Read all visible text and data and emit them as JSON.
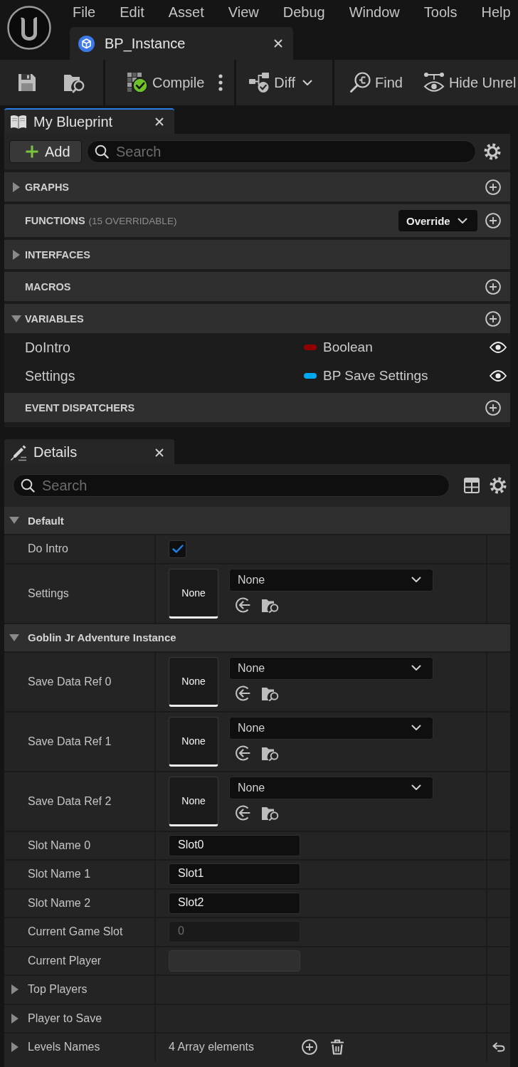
{
  "menu_bar": {
    "items": [
      "File",
      "Edit",
      "Asset",
      "View",
      "Debug",
      "Window",
      "Tools",
      "Help"
    ]
  },
  "document_tabs": [
    {
      "title": "BP_Instance",
      "selected": true
    }
  ],
  "toolbar": {
    "groups": [
      [
        {
          "kind": "save"
        },
        {
          "kind": "browse"
        }
      ],
      [
        {
          "kind": "compile",
          "label": "Compile"
        },
        {
          "kind": "more"
        }
      ],
      [
        {
          "kind": "diff",
          "label": "Diff"
        }
      ],
      [
        {
          "kind": "find",
          "label": "Find"
        },
        {
          "kind": "hide",
          "label": "Hide Unrel"
        }
      ]
    ]
  },
  "my_blueprint": {
    "tab": {
      "title": "My Blueprint",
      "active": true
    },
    "add_button": {
      "label": "Add"
    },
    "search": {
      "placeholder": "Search"
    },
    "sections": [
      {
        "title": "GRAPHS",
        "expanded": false,
        "add": true
      },
      {
        "title": "FUNCTIONS",
        "note": "(15 OVERRIDABLE)",
        "dropdown": "Override",
        "add": true
      },
      {
        "title": "INTERFACES",
        "expanded": false,
        "add": false
      },
      {
        "title": "MACROS",
        "add": true
      },
      {
        "title": "VARIABLES",
        "expanded": true,
        "add": true,
        "items": [
          {
            "name": "DoIntro",
            "type": "Boolean",
            "color": "#930000",
            "public": true
          },
          {
            "name": "Settings",
            "type": "BP Save Settings",
            "color": "#00a8f0",
            "public": true
          }
        ]
      },
      {
        "title": "EVENT DISPATCHERS",
        "add": true
      }
    ]
  },
  "details": {
    "tab": {
      "title": "Details",
      "active": false
    },
    "search": {
      "placeholder": "Search"
    },
    "categories": [
      {
        "title": "Default",
        "expanded": true,
        "properties": [
          {
            "kind": "checkbox",
            "label": "Do Intro",
            "checked": true
          },
          {
            "kind": "object",
            "label": "Settings",
            "thumbnail": "None",
            "value": "None"
          }
        ]
      },
      {
        "title": "Goblin Jr Adventure Instance",
        "expanded": true,
        "properties": [
          {
            "kind": "object",
            "label": "Save Data Ref 0",
            "thumbnail": "None",
            "value": "None"
          },
          {
            "kind": "object",
            "label": "Save Data Ref 1",
            "thumbnail": "None",
            "value": "None"
          },
          {
            "kind": "object",
            "label": "Save Data Ref 2",
            "thumbnail": "None",
            "value": "None"
          },
          {
            "kind": "text",
            "label": "Slot Name 0",
            "value": "Slot0",
            "disabled": false
          },
          {
            "kind": "text",
            "label": "Slot Name 1",
            "value": "Slot1",
            "disabled": false
          },
          {
            "kind": "text",
            "label": "Slot Name 2",
            "value": "Slot2",
            "disabled": false
          },
          {
            "kind": "text",
            "label": "Current Game Slot",
            "value": "0",
            "disabled": true
          },
          {
            "kind": "blank",
            "label": "Current Player"
          },
          {
            "kind": "group",
            "label": "Top Players",
            "expanded": false
          },
          {
            "kind": "group",
            "label": "Player to Save",
            "expanded": false
          },
          {
            "kind": "array",
            "label": "Levels Names",
            "expanded": false,
            "summary": "4 Array elements"
          }
        ]
      }
    ]
  }
}
